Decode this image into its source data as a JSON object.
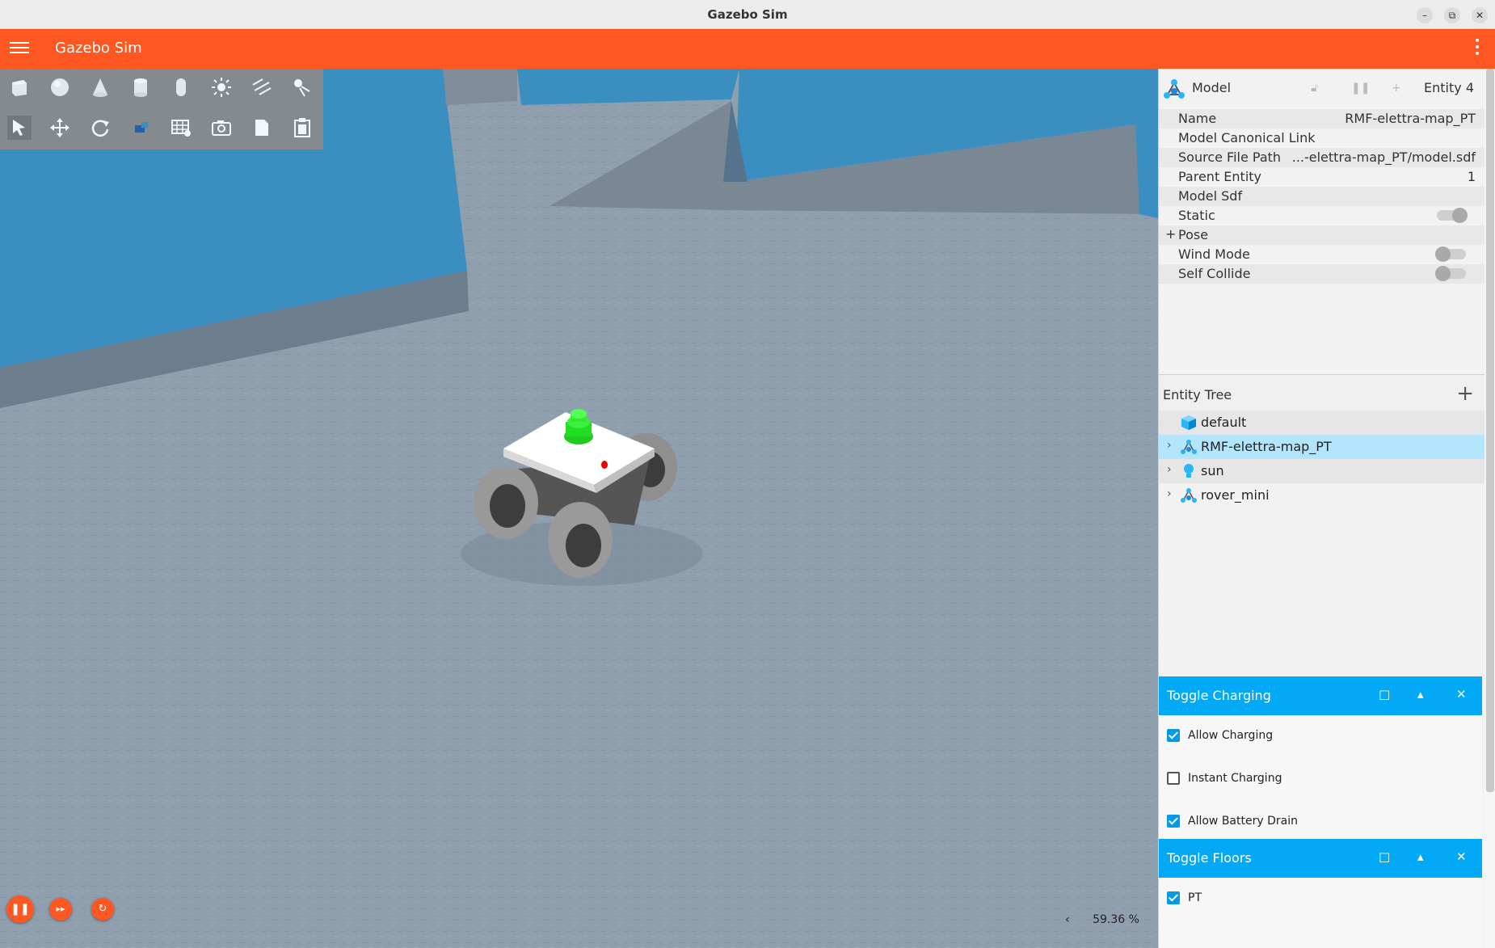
{
  "window": {
    "title": "Gazebo Sim",
    "controls": [
      "minimize-icon",
      "restore-icon",
      "close-icon"
    ]
  },
  "appbar": {
    "title": "Gazebo Sim",
    "color": "#ff5722"
  },
  "toolbar": {
    "shapes": [
      "box-icon",
      "sphere-icon",
      "cone-icon",
      "cylinder-icon",
      "capsule-icon",
      "point-light-icon",
      "directional-light-icon",
      "spot-light-icon"
    ],
    "tools": [
      "select-icon",
      "translate-icon",
      "rotate-icon",
      "transform-control-icon",
      "grid-snap-icon",
      "screenshot-icon",
      "copy-icon",
      "paste-icon"
    ]
  },
  "sim_controls": [
    "pause-icon",
    "step-icon",
    "reset-icon"
  ],
  "rtf": {
    "value": "59.36 %",
    "chevron": "‹"
  },
  "component_inspector": {
    "type_label": "Model",
    "entity_label": "Entity 4",
    "rows": [
      {
        "key": "Name",
        "value": "RMF-elettra-map_PT"
      },
      {
        "key": "Model Canonical Link",
        "value": ""
      },
      {
        "key": "Source File Path",
        "value": "...-elettra-map_PT/model.sdf"
      },
      {
        "key": "Parent Entity",
        "value": "1"
      },
      {
        "key": "Model Sdf",
        "value": ""
      },
      {
        "key": "Static",
        "toggle": true
      },
      {
        "key": "Pose",
        "expandable": true,
        "prefix": "+"
      },
      {
        "key": "Wind Mode",
        "toggle": false
      },
      {
        "key": "Self Collide",
        "toggle": false
      }
    ]
  },
  "entity_tree": {
    "title": "Entity Tree",
    "add_label": "+",
    "items": [
      {
        "name": "default",
        "icon": "world-icon",
        "expandable": false
      },
      {
        "name": "RMF-elettra-map_PT",
        "icon": "model-icon",
        "expandable": true,
        "selected": true
      },
      {
        "name": "sun",
        "icon": "light-icon",
        "expandable": true
      },
      {
        "name": "rover_mini",
        "icon": "model-icon",
        "expandable": true
      }
    ]
  },
  "toggle_charging": {
    "title": "Toggle Charging",
    "options": [
      {
        "label": "Allow Charging",
        "checked": true
      },
      {
        "label": "Instant Charging",
        "checked": false
      },
      {
        "label": "Allow Battery Drain",
        "checked": true
      }
    ]
  },
  "toggle_floors": {
    "title": "Toggle Floors",
    "options": [
      {
        "label": "PT",
        "checked": true
      }
    ]
  },
  "plugin_buttons": {
    "maximize": "□",
    "collapse": "▴",
    "close": "✕"
  },
  "colors": {
    "accent": "#ff5722",
    "plugin_header": "#03a9f4",
    "selection": "#b3e5fc",
    "wall": "#3a8fc0"
  }
}
